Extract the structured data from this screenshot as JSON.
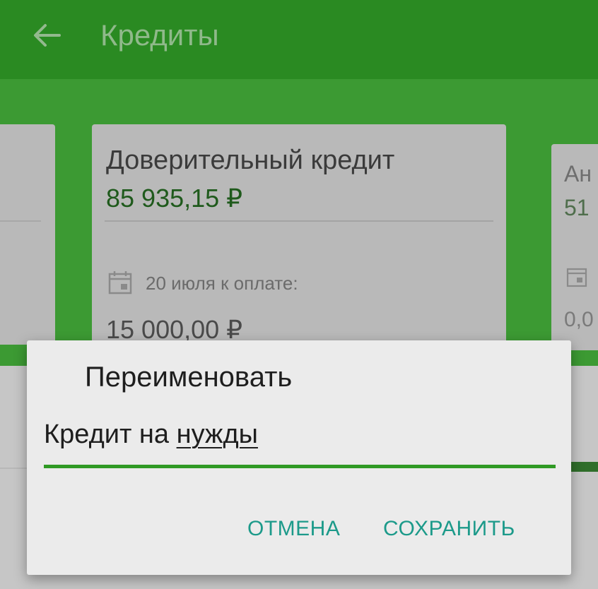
{
  "appbar": {
    "title": "Кредиты",
    "back_icon": "arrow-left-icon"
  },
  "cards": {
    "main": {
      "name": "Доверительный кредит",
      "amount": "85 935,15 ₽",
      "due_label": "20 июля к оплате:",
      "payment": "15 000,00 ₽",
      "calendar_icon": "calendar-icon"
    },
    "right": {
      "name_partial": "Ан",
      "amount_partial": "51",
      "payment_partial": "0,0",
      "calendar_icon": "calendar-icon"
    }
  },
  "dialog": {
    "title": "Переименовать",
    "field_prefix": "Кредит на ",
    "field_word": "нужды",
    "cancel_label": "ОТМЕНА",
    "save_label": "СОХРАНИТЬ"
  },
  "colors": {
    "appbar": "#2a8a22",
    "accent_line": "#2f9a24",
    "button_text": "#1c9a8a",
    "dialog_bg": "#ebebeb"
  }
}
